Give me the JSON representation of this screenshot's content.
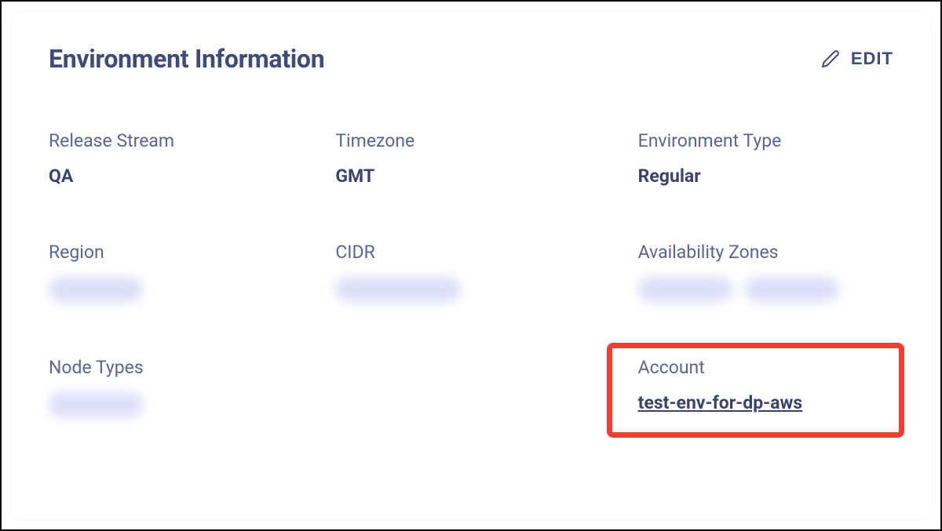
{
  "header": {
    "title": "Environment Information",
    "edit_label": "EDIT"
  },
  "fields": {
    "release_stream": {
      "label": "Release Stream",
      "value": "QA"
    },
    "timezone": {
      "label": "Timezone",
      "value": "GMT"
    },
    "environment_type": {
      "label": "Environment Type",
      "value": "Regular"
    },
    "region": {
      "label": "Region"
    },
    "cidr": {
      "label": "CIDR"
    },
    "availability_zones": {
      "label": "Availability Zones"
    },
    "node_types": {
      "label": "Node Types"
    },
    "account": {
      "label": "Account",
      "value": "test-env-for-dp-aws"
    }
  }
}
